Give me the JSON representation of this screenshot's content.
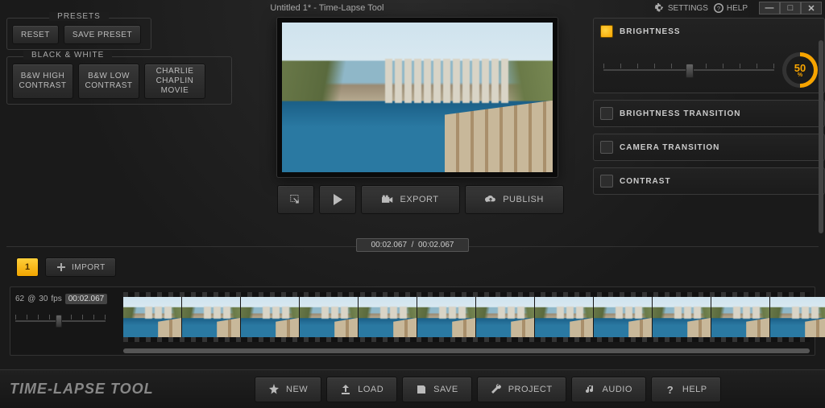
{
  "title": "Untitled 1* - Time-Lapse Tool",
  "top": {
    "settings": "SETTINGS",
    "help": "HELP"
  },
  "presets": {
    "legend": "PRESETS",
    "reset": "RESET",
    "save": "SAVE PRESET",
    "bw_legend": "BLACK & WHITE",
    "items": [
      "B&W HIGH CONTRAST",
      "B&W LOW CONTRAST",
      "CHARLIE CHAPLIN MOVIE"
    ]
  },
  "preview": {
    "export": "EXPORT",
    "publish": "PUBLISH",
    "time_current": "00:02.067",
    "time_total": "00:02.067"
  },
  "effects": {
    "brightness": {
      "label": "BRIGHTNESS",
      "value": 50,
      "unit": "%",
      "checked": true
    },
    "brightness_transition": {
      "label": "BRIGHTNESS TRANSITION",
      "checked": false
    },
    "camera_transition": {
      "label": "CAMERA TRANSITION",
      "checked": false
    },
    "contrast": {
      "label": "CONTRAST",
      "checked": false
    }
  },
  "sequence": {
    "active": "1",
    "import": "IMPORT"
  },
  "timeline": {
    "frame_count": 62,
    "fps": 30,
    "duration": "00:02.067"
  },
  "footer": {
    "logo": "TIME-LAPSE TOOL",
    "buttons": [
      "NEW",
      "LOAD",
      "SAVE",
      "PROJECT",
      "AUDIO",
      "HELP"
    ]
  }
}
